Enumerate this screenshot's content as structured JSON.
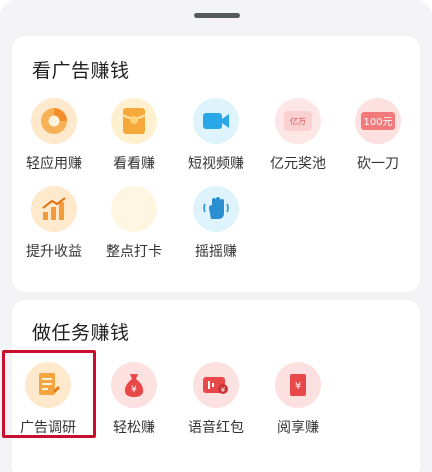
{
  "sections": {
    "ads": {
      "title": "看广告赚钱",
      "items": [
        {
          "label": "轻应用赚",
          "icon": "pie-chart-icon"
        },
        {
          "label": "看看赚",
          "icon": "red-envelope-icon"
        },
        {
          "label": "短视频赚",
          "icon": "video-camera-icon"
        },
        {
          "label": "亿元奖池",
          "icon": "prize-pool-icon",
          "badge_text": "亿万"
        },
        {
          "label": "砍一刀",
          "icon": "coupon-icon",
          "badge_text": "100元"
        },
        {
          "label": "提升收益",
          "icon": "rising-chart-icon"
        },
        {
          "label": "整点打卡",
          "icon": "clock-in-icon"
        },
        {
          "label": "摇摇赚",
          "icon": "shaking-hand-icon"
        }
      ]
    },
    "tasks": {
      "title": "做任务赚钱",
      "items": [
        {
          "label": "广告调研",
          "icon": "survey-icon"
        },
        {
          "label": "轻松赚",
          "icon": "money-bag-icon"
        },
        {
          "label": "语音红包",
          "icon": "voice-red-packet-icon"
        },
        {
          "label": "阅享赚",
          "icon": "reading-icon"
        }
      ]
    }
  },
  "colors": {
    "highlight_border": "#c8102e",
    "orange": "#f59a3a",
    "blue": "#2aa7e8",
    "red": "#e84848"
  }
}
